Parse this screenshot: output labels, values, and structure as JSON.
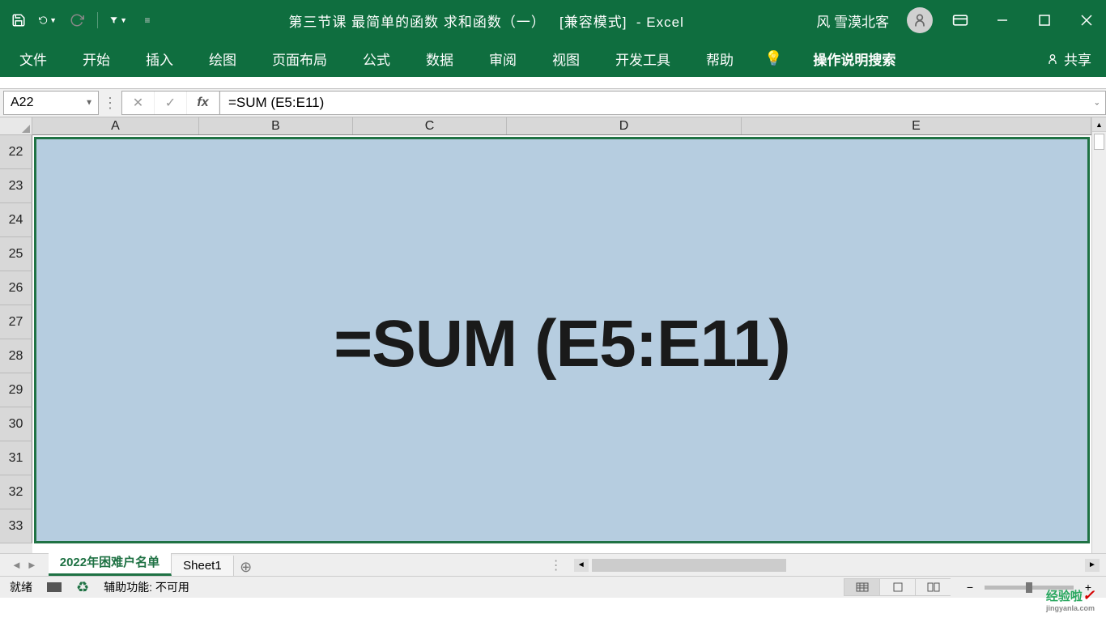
{
  "title": {
    "doc": "第三节课 最简单的函数 求和函数（一）",
    "mode": "[兼容模式]",
    "app": "- Excel",
    "user": "风 雪漠北客"
  },
  "ribbon": {
    "tabs": [
      "文件",
      "开始",
      "插入",
      "绘图",
      "页面布局",
      "公式",
      "数据",
      "审阅",
      "视图",
      "开发工具",
      "帮助"
    ],
    "tell_me": "操作说明搜索",
    "share": "共享"
  },
  "formula_bar": {
    "name_box": "A22",
    "formula": "=SUM (E5:E11)"
  },
  "columns": [
    "A",
    "B",
    "C",
    "D",
    "E"
  ],
  "rows": [
    "22",
    "23",
    "24",
    "25",
    "26",
    "27",
    "28",
    "29",
    "30",
    "31",
    "32",
    "33"
  ],
  "big_text": "=SUM (E5:E11)",
  "sheets": {
    "active": "2022年困难户名单",
    "other": "Sheet1"
  },
  "status": {
    "ready": "就绪",
    "accessibility": "辅助功能: 不可用"
  },
  "watermark": {
    "main": "经验啦",
    "sub": "jingyanla.com"
  }
}
